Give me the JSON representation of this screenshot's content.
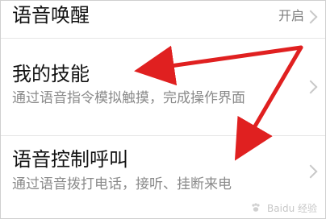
{
  "settings": {
    "items": [
      {
        "title": "语音唤醒",
        "value": "开启"
      },
      {
        "title": "我的技能",
        "subtitle": "通过语音指令模拟触摸，完成操作界面"
      },
      {
        "title": "语音控制呼叫",
        "subtitle": "通过语音拨打电话，接听、挂断来电"
      }
    ]
  },
  "annotations": {
    "arrow_color": "#e02020",
    "watermark_text": "Baidu 经验"
  },
  "icons": {
    "chevron": "chevron-right-icon",
    "watermark_logo": "baidu-paw-icon"
  }
}
